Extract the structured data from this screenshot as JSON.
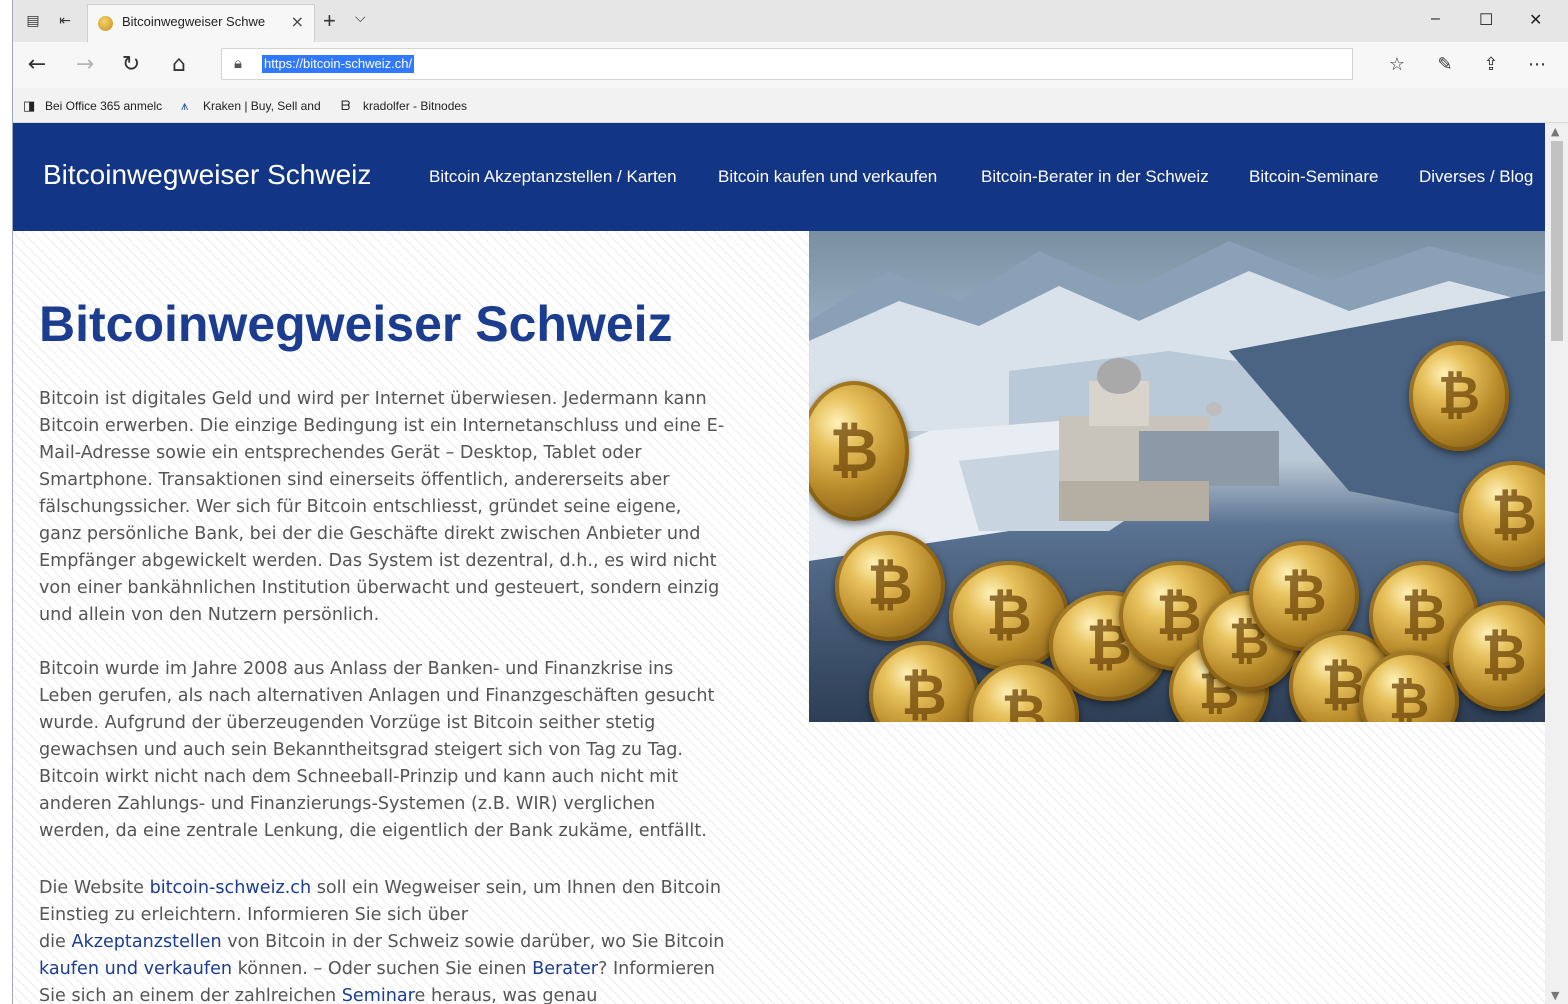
{
  "browser": {
    "tab_title": "Bitcoinwegweiser Schwe",
    "new_tab_symbol": "+",
    "close_symbol": "×",
    "address_url": "https://bitcoin-schweiz.ch/",
    "window_controls": {
      "minimize": "–",
      "maximize": "☐",
      "close": "✕"
    },
    "favorites": [
      {
        "label": "Bei Office 365 anmelc",
        "icon": "office-icon"
      },
      {
        "label": "Kraken | Buy, Sell and",
        "icon": "kraken-icon"
      },
      {
        "label": "kradolfer - Bitnodes",
        "icon": "bitnodes-icon"
      }
    ],
    "accent_color": "#3079ff"
  },
  "site": {
    "brand": "Bitcoinwegweiser Schweiz",
    "header_color": "#123585",
    "menu": [
      "Bitcoin Akzeptanzstellen / Karten",
      "Bitcoin kaufen und verkaufen",
      "Bitcoin-Berater in der Schweiz",
      "Bitcoin-Seminare",
      "Diverses / Blog"
    ]
  },
  "content": {
    "title": "Bitcoinwegweiser Schweiz",
    "paragraph1": "Bitcoin ist digitales Geld und wird per Internet überwiesen. Jedermann kann Bitcoin erwerben. Die einzige Bedingung ist ein Internetanschluss und eine E-Mail-Adresse sowie ein entsprechendes Gerät – Desktop, Tablet oder Smartphone. Transaktionen sind einerseits öffentlich, andererseits aber fälschungssicher. Wer sich für Bitcoin entschliesst, gründet seine eigene, ganz persönliche Bank, bei der die Geschäfte direkt zwischen Anbieter und Empfänger abgewickelt werden. Das System ist dezentral, d.h., es wird nicht von einer bankähnlichen Institution überwacht und gesteuert, sondern einzig und allein von den Nutzern persönlich.",
    "paragraph2": "Bitcoin wurde im Jahre 2008 aus Anlass der Banken- und Finanzkrise ins Leben gerufen, als nach alternativen Anlagen und Finanzgeschäften gesucht wurde. Aufgrund der überzeugenden Vorzüge ist Bitcoin seither stetig gewachsen und auch sein Bekanntheitsgrad steigert sich von Tag zu Tag. Bitcoin wirkt nicht nach dem Schneeball-Prinzip und kann auch nicht mit anderen Zahlungs- und Finanzierungs-Systemen (z.B. WIR) verglichen werden, da eine zentrale Lenkung, die eigentlich der Bank zukäme, entfällt.",
    "paragraph3": {
      "t1": "Die Website ",
      "link1": "bitcoin-schweiz.ch",
      "t2": " soll ein Wegweiser sein, um Ihnen den Bitcoin Einstieg zu erleichtern. Informieren Sie sich über",
      "t3": " die ",
      "link2": "Akzeptanzstellen",
      "t4": " von Bitcoin in der Schweiz sowie darüber, wo Sie Bitcoin ",
      "link3": "kaufen und verkaufen",
      "t5": " können. –  Oder suchen Sie einen ",
      "link4": "Berater",
      "t6": "? Informieren Sie sich an einem der zahlreichen ",
      "link5": "Seminar",
      "t7": "e heraus, was genau"
    },
    "link_color": "#1b3c8f",
    "title_color": "#1b3c8f"
  }
}
